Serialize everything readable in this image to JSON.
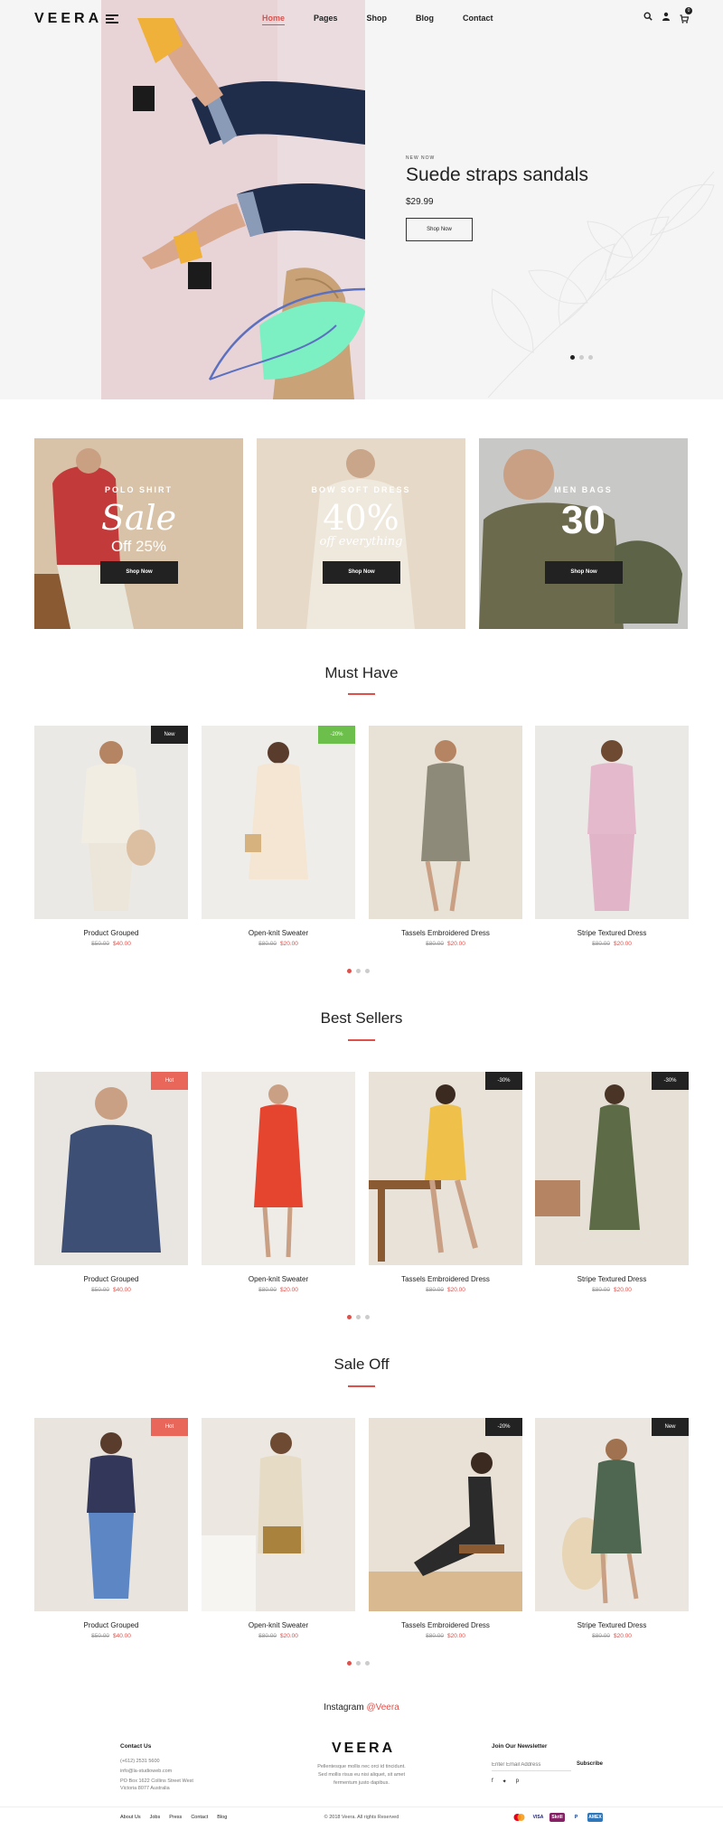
{
  "header": {
    "logo": "VEERA",
    "nav": [
      "Home",
      "Pages",
      "Shop",
      "Blog",
      "Contact"
    ],
    "cart_count": "0"
  },
  "hero": {
    "kicker": "NEW NOW",
    "title": "Suede straps sandals",
    "price": "$29.99",
    "button": "Shop Now"
  },
  "banners": [
    {
      "subtitle": "POLO SHIRT",
      "big": "Sale",
      "small": "Off 25%",
      "button": "Shop Now"
    },
    {
      "subtitle": "BOW SOFT DRESS",
      "big": "40%",
      "small": "off everything",
      "button": "Shop Now"
    },
    {
      "subtitle": "MEN BAGS",
      "big": "30",
      "small": "",
      "button": "Shop Now"
    }
  ],
  "sections": [
    {
      "title": "Must Have",
      "products": [
        {
          "name": "Product Grouped",
          "old": "$50.00",
          "price": "$40.00",
          "tag": "New",
          "tag_color": "#222222"
        },
        {
          "name": "Open-knit Sweater",
          "old": "$80.00",
          "price": "$20.00",
          "tag": "-20%",
          "tag_color": "#6cbf4b"
        },
        {
          "name": "Tassels Embroidered Dress",
          "old": "$80.00",
          "price": "$20.00",
          "tag": "",
          "tag_color": ""
        },
        {
          "name": "Stripe Textured Dress",
          "old": "$80.00",
          "price": "$20.00",
          "tag": "",
          "tag_color": ""
        }
      ]
    },
    {
      "title": "Best Sellers",
      "products": [
        {
          "name": "Product Grouped",
          "old": "$50.00",
          "price": "$40.00",
          "tag": "Hot",
          "tag_color": "#e9665b"
        },
        {
          "name": "Open-knit Sweater",
          "old": "$80.00",
          "price": "$20.00",
          "tag": "",
          "tag_color": ""
        },
        {
          "name": "Tassels Embroidered Dress",
          "old": "$80.00",
          "price": "$20.00",
          "tag": "-30%",
          "tag_color": "#222222"
        },
        {
          "name": "Stripe Textured Dress",
          "old": "$80.00",
          "price": "$20.00",
          "tag": "-30%",
          "tag_color": "#222222"
        }
      ]
    },
    {
      "title": "Sale Off",
      "products": [
        {
          "name": "Product Grouped",
          "old": "$50.00",
          "price": "$40.00",
          "tag": "Hot",
          "tag_color": "#e9665b"
        },
        {
          "name": "Open-knit Sweater",
          "old": "$80.00",
          "price": "$20.00",
          "tag": "",
          "tag_color": ""
        },
        {
          "name": "Tassels Embroidered Dress",
          "old": "$80.00",
          "price": "$20.00",
          "tag": "-20%",
          "tag_color": "#222222"
        },
        {
          "name": "Stripe Textured Dress",
          "old": "$80.00",
          "price": "$20.00",
          "tag": "New",
          "tag_color": "#222222"
        }
      ]
    }
  ],
  "instagram": {
    "label": "Instagram",
    "handle": "@Veera"
  },
  "footer": {
    "contact_title": "Contact Us",
    "phone": "(+612) 2531 5600",
    "email": "info@la-studioweb.com",
    "address1": "PO Box 1622 Collins Street West",
    "address2": "Victoria 8077 Australia",
    "logo": "VEERA",
    "about1": "Pellentesque mollis nec orci id tincidunt.",
    "about2": "Sed mollis risus eu nisi aliquet, sit amet",
    "about3": "fermentum justo dapibus.",
    "newsletter_title": "Join Our Newsletter",
    "email_placeholder": "Enter Email Address",
    "subscribe": "Subscribe",
    "links": [
      "About Us",
      "Jobs",
      "Press",
      "Contact",
      "Blog"
    ],
    "copyright": "© 2018 Veera. All rights Reserved",
    "payments": [
      "mastercard",
      "VISA",
      "Skrill",
      "PayPal",
      "AMEX"
    ]
  },
  "colors": {
    "accent": "#e0504a",
    "dark": "#222222"
  }
}
